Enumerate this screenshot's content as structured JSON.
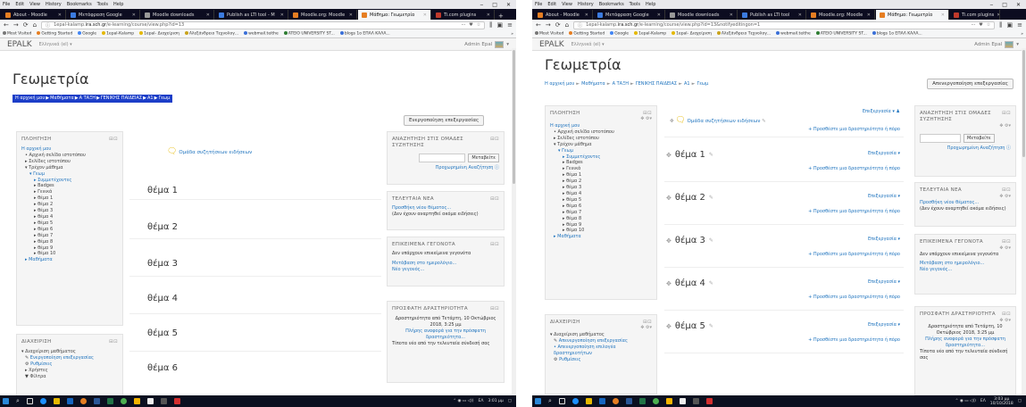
{
  "browser": {
    "menu": [
      "File",
      "Edit",
      "View",
      "History",
      "Bookmarks",
      "Tools",
      "Help"
    ],
    "window_controls": [
      "‒",
      "□",
      "✕"
    ],
    "left_tabs": [
      {
        "label": "About - Moodle",
        "color": "#e67e22",
        "active": false
      },
      {
        "label": "Μετάφραση Google",
        "color": "#3b7be0",
        "active": false
      },
      {
        "label": "Moodle downloads",
        "color": "#999999",
        "active": false
      },
      {
        "label": "Publish as LTI tool - M",
        "color": "#3b7be0",
        "active": false
      },
      {
        "label": "Moodle.org: Moodle",
        "color": "#e67e22",
        "active": false
      },
      {
        "label": "Μάθημα: Γεωμετρία",
        "color": "#e67e22",
        "active": true
      },
      {
        "label": "Ti.com plugins",
        "color": "#c0392b",
        "active": false
      }
    ],
    "right_tabs": [
      {
        "label": "About - Moodle",
        "color": "#e67e22",
        "active": false
      },
      {
        "label": "Μετάφραση Google",
        "color": "#3b7be0",
        "active": false
      },
      {
        "label": "Moodle downloads",
        "color": "#999999",
        "active": false
      },
      {
        "label": "Publish as LTI tool",
        "color": "#3b7be0",
        "active": false
      },
      {
        "label": "Moodle.org: Moodle",
        "color": "#e67e22",
        "active": false
      },
      {
        "label": "Μάθημα: Γεωμετρία",
        "color": "#e67e22",
        "active": true
      },
      {
        "label": "Ti.com plugins",
        "color": "#c0392b",
        "active": false
      }
    ],
    "url_left_prefix": "1epal-kalamp.",
    "url_left_domain": "ira.sch.gr",
    "url_left_path": "/e-learning/course/view.php?id=13",
    "url_right_prefix": "1epal-kalamp.",
    "url_right_domain": "ira.sch.gr",
    "url_right_path": "/e-learning/course/view.php?id=13&notifyeditingon=1",
    "nav_icons": [
      "←",
      "→",
      "⟳",
      "⌂"
    ],
    "more_icon": "···",
    "bookmarks": [
      "Most Visited",
      "Getting Started",
      "Google",
      "1epal-Kalamp",
      "1epal- Διαχείριση",
      "Αλεξάνδρειο Τεχνολογ...",
      "webmail.teithe",
      "ATEIO UNIVERSITY ST...",
      "blogs 1ο ΕΠΑΛ ΚΑΛΑ..."
    ]
  },
  "site": {
    "brand": "EPALK",
    "lang": "Ελληνικά (el) ▾",
    "admin": "Admin Epal"
  },
  "page": {
    "title": "Γεωμετρία",
    "breadcrumb": [
      "Η αρχική μου",
      "Μαθήματα",
      "Α ΤΑΞΗ",
      "ΓΕΝΙΚΗΣ ΠΑΙΔΕΙΑΣ",
      "Α1",
      "Γεωμ"
    ],
    "edit_on_label": "Ενεργοποίηση επεξεργασίας",
    "edit_off_label": "Απενεργοποίηση επεξεργασίας"
  },
  "nav_block": {
    "title": "ΠΛΟΗΓΗΣΗ",
    "home": "Η αρχική μου",
    "items_top": [
      "Αρχική σελίδα ιστοτόπου",
      "Σελίδες ιστοτόπου",
      "Τρέχον μάθημα"
    ],
    "course": "Γεωμ",
    "course_items": [
      "Συμμετέχοντες",
      "Badges",
      "Γενικά",
      "θέμα 1",
      "θέμα 2",
      "θέμα 3",
      "θέμα 4",
      "θέμα 5",
      "θέμα 6",
      "θέμα 7",
      "θέμα 8",
      "θέμα 9",
      "θέμα 10"
    ],
    "bottom": "Μαθήματα"
  },
  "admin_block": {
    "title": "ΔΙΑΧΕΙΡΙΣΗ",
    "course_admin": "Διαχείριση μαθήματος",
    "items_left": [
      "Ενεργοποίηση επεξεργασίας",
      "Ρυθμίσεις",
      "Χρήστες",
      "Φίλτρα"
    ],
    "items_right": [
      "Απενεργοποίηση επεξεργασίας",
      "Απενεργοποίηση επιλογέα δραστηριοτήτων",
      "Ρυθμίσεις"
    ]
  },
  "forum": "Ομάδα συζητήσεων ειδήσεων",
  "sections": [
    "θέμα 1",
    "θέμα 2",
    "θέμα 3",
    "θέμα 4",
    "θέμα 5",
    "θέμα 6"
  ],
  "edit_menu": "Επεξεργασία ▾",
  "add_activity": "+ Προσθέστε μια δραστηριότητα ή πόρο",
  "right_blocks": {
    "search_title": "ΑΝΑΖΗΤΗΣΗ ΣΤΙΣ ΟΜΑΔΕΣ ΣΥΖΗΤΗΣΗΣ",
    "search_btn": "Μεταβείτε",
    "adv_search": "Προχωρημένη Αναζήτηση ⓘ",
    "news_title": "ΤΕΛΕΥΤΑΙΑ ΝΕΑ",
    "news_add": "Προσθήκη νέου θέματος...",
    "news_empty": "(Δεν έχουν αναρτηθεί ακόμα ειδήσεις)",
    "events_title": "ΕΠΙΚΕΙΜΕΝΑ ΓΕΓΟΝΟΤΑ",
    "events_empty": "Δεν υπάρχουν επικείμενα γεγονότα",
    "events_cal": "Μετάβαση στο ημερολόγιο...",
    "events_new": "Νέο γεγονός...",
    "recent_title": "ΠΡΟΣΦΑΤΗ ΔΡΑΣΤΗΡΙΟΤΗΤΑ",
    "recent_since": "Δραστηριότητα από Τετάρτη, 10 Οκτώβριος 2018, 3:25 μμ",
    "recent_full": "Πλήρης αναφορά για την πρόσφατη δραστηριότητα...",
    "recent_none": "Τίποτα νέο από την τελευταία σύνδεσή σας"
  },
  "tray": {
    "clock_left": "3:01 μμ",
    "clock_right_time": "3:03 μμ",
    "clock_right_date": "10/10/2018",
    "lang": "ΕΛ"
  }
}
